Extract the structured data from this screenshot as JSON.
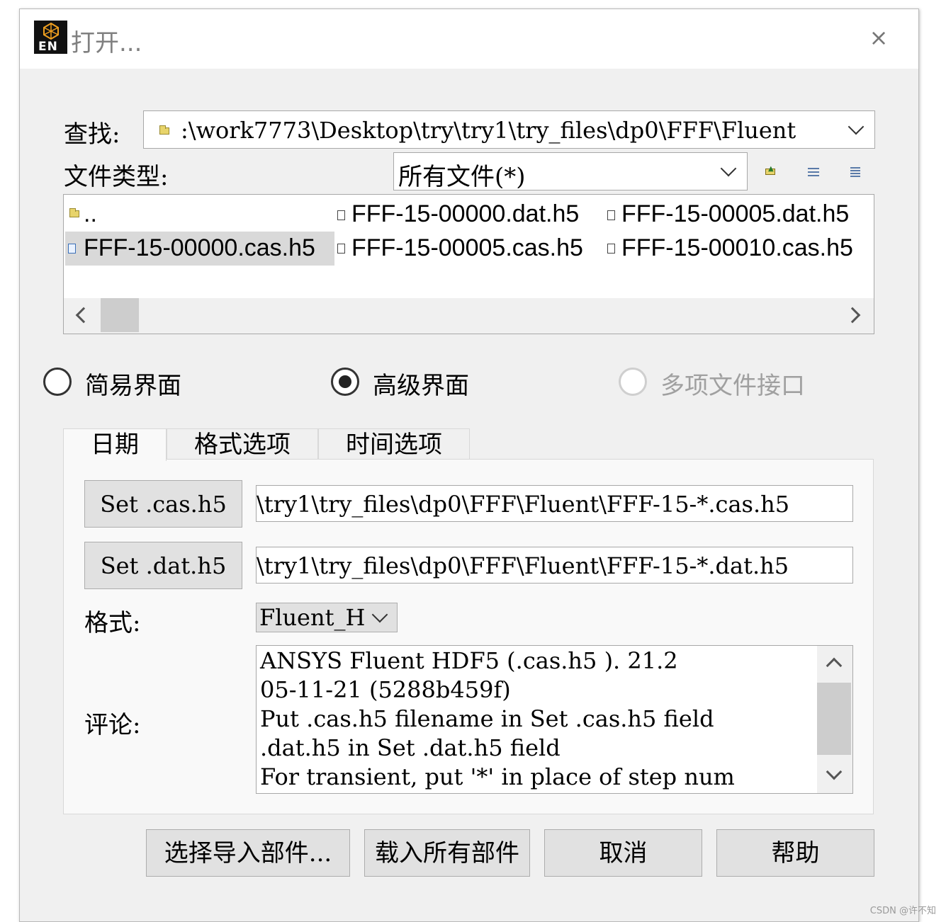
{
  "window": {
    "title": "打开...",
    "app_icon_text": "EN",
    "close_glyph": "×"
  },
  "lookin": {
    "label": "查找:",
    "path": ":\\work7773\\Desktop\\try\\try1\\try_files\\dp0\\FFF\\Fluent"
  },
  "filetype": {
    "label": "文件类型:",
    "value": "所有文件(*)"
  },
  "files": {
    "col1": [
      "..",
      "FFF-15-00000.cas.h5"
    ],
    "col2": [
      "FFF-15-00000.dat.h5",
      "FFF-15-00005.cas.h5"
    ],
    "col3": [
      "FFF-15-00005.dat.h5",
      "FFF-15-00010.cas.h5"
    ],
    "selected": "FFF-15-00000.cas.h5"
  },
  "modes": {
    "simple": "简易界面",
    "advanced": "高级界面",
    "multi": "多项文件接口",
    "selected": "advanced"
  },
  "tabs": [
    "日期",
    "格式选项",
    "时间选项"
  ],
  "form": {
    "set_cas_label": "Set .cas.h5",
    "cas_value": "\\try1\\try_files\\dp0\\FFF\\Fluent\\FFF-15-*.cas.h5",
    "set_dat_label": "Set .dat.h5",
    "dat_value": "\\try1\\try_files\\dp0\\FFF\\Fluent\\FFF-15-*.dat.h5",
    "format_label": "格式:",
    "format_value": "Fluent_H",
    "comment_label": "评论:",
    "comment_lines": [
      "ANSYS Fluent HDF5 (.cas.h5 ).  21.2",
      "05-11-21 (5288b459f)",
      "Put .cas.h5 filename in Set .cas.h5 field",
      ".dat.h5 in Set .dat.h5 field",
      "For transient, put '*' in place of step num"
    ]
  },
  "buttons": {
    "select_parts": "选择导入部件...",
    "load_all": "载入所有部件",
    "cancel": "取消",
    "help": "帮助"
  },
  "watermark": "CSDN @许不知"
}
